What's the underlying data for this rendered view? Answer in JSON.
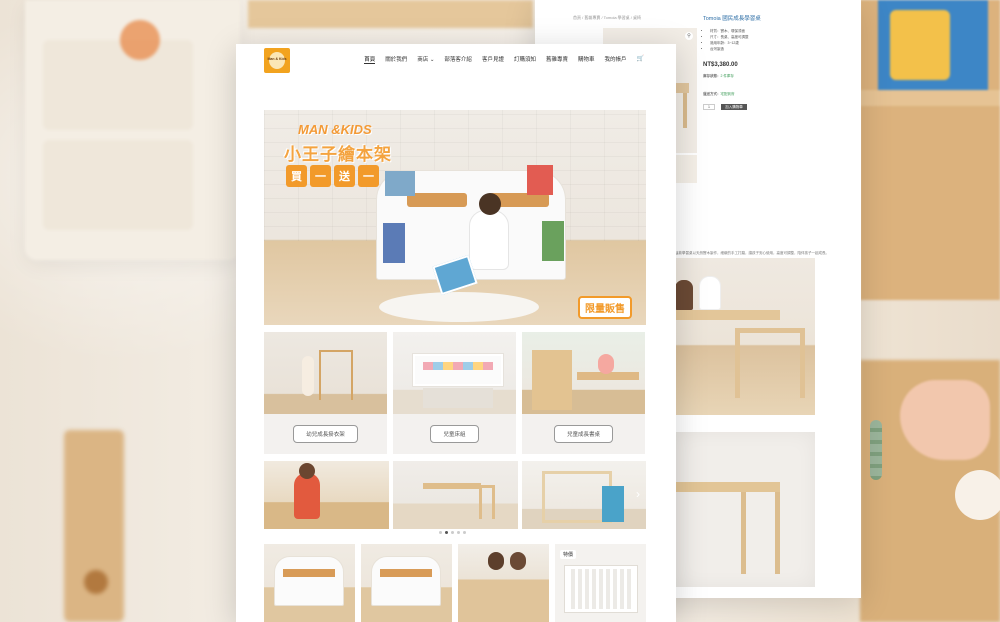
{
  "site": {
    "logo_text": "Man & Kids",
    "nav": [
      "首頁",
      "關於我們",
      "商店",
      "部落客介紹",
      "客戶見證",
      "訂購須知",
      "舊雜專賣",
      "購物車",
      "我的帳戶"
    ],
    "hero": {
      "brand": "MAN &KIDS",
      "title": "小王子繪本架",
      "promo_chars": [
        "買",
        "一",
        "送",
        "一"
      ],
      "badge": "限量販售"
    },
    "categories": [
      {
        "label": "幼兒成長掛衣架"
      },
      {
        "label": "兒童床組"
      },
      {
        "label": "兒童成長書桌"
      }
    ],
    "slider_dots": 5,
    "slider_active": 1,
    "product_tag": "特價"
  },
  "product_page": {
    "breadcrumb": "首頁 / 舊雜專賣 / Tomoia 學習桌 / 桌椅",
    "title": "Tomoia 國民成長學習桌",
    "bullets": [
      "材質：實木、環保漆面",
      "尺寸：長桌、高度可調整",
      "適用年齡：3~12歲",
      "台灣製造"
    ],
    "price": "NT$3,380.00",
    "stock_line1_label": "庫存狀態：",
    "stock_line1_value": "2 件庫存",
    "stock_line2_label": "運送方式：",
    "stock_line2_value": "宅配到府",
    "qty": "1",
    "add_to_cart": "加入購物車",
    "description": "這款學習桌以天然實木製作，細緻的手工打磨，讓孩子安心使用，高度可調整，陪伴孩子一起成長。"
  },
  "colors": {
    "brand_orange": "#f29a2a",
    "link_blue": "#2d6ea6",
    "in_stock_green": "#3a9a55"
  }
}
